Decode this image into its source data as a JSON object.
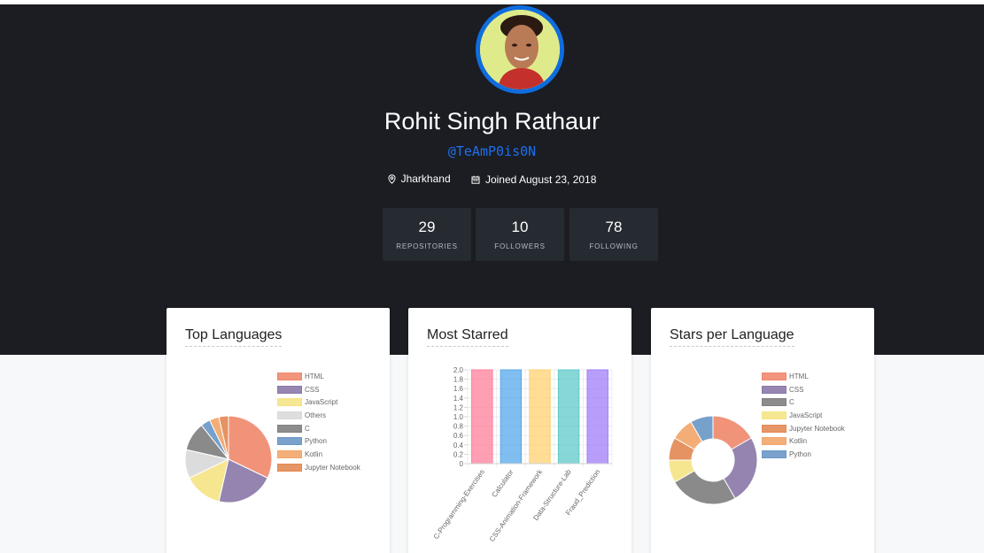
{
  "profile": {
    "name": "Rohit Singh Rathaur",
    "handle": "@TeAmP0is0N",
    "location": "Jharkhand",
    "joined": "Joined August 23, 2018",
    "icons": {
      "location": "map-pin-icon",
      "joined": "calendar-icon"
    },
    "colors": {
      "background": "#1b1d23",
      "handle": "#1f6feb",
      "avatar_ring": "#0f6dde"
    }
  },
  "stats": [
    {
      "value": "29",
      "label": "REPOSITORIES"
    },
    {
      "value": "10",
      "label": "FOLLOWERS"
    },
    {
      "value": "78",
      "label": "FOLLOWING"
    }
  ],
  "cards": {
    "languages": {
      "title": "Top Languages"
    },
    "starred": {
      "title": "Most Starred"
    },
    "stars_per_language": {
      "title": "Stars per Language"
    }
  },
  "chart_data": [
    {
      "type": "pie",
      "title": "Top Languages",
      "labels": [
        "HTML",
        "CSS",
        "JavaScript",
        "Others",
        "C",
        "Python",
        "Kotlin",
        "Jupyter Notebook"
      ],
      "values": [
        9,
        6,
        4,
        3,
        3,
        1,
        1,
        1
      ],
      "colors": [
        "#ef8a6e",
        "#8b79a8",
        "#f5e487",
        "#d9d9d9",
        "#808080",
        "#6b98c7",
        "#f2a66a",
        "#e38a55"
      ],
      "legend": "right"
    },
    {
      "type": "bar",
      "title": "Most Starred",
      "categories": [
        "C-Programming-Exercises",
        "Calculator",
        "CSS-Animation-Framework",
        "Data-Structure-Lab",
        "Fraud_Prediction"
      ],
      "values": [
        2,
        2,
        2,
        2,
        2
      ],
      "colors": [
        "#ff7f9b",
        "#56a8ec",
        "#ffd271",
        "#5fcac9",
        "#a07ef8"
      ],
      "ylim": [
        0,
        2
      ],
      "yticks": [
        "0",
        "0.2",
        "0.4",
        "0.6",
        "0.8",
        "1.0",
        "1.2",
        "1.4",
        "1.6",
        "1.8",
        "2.0"
      ],
      "grid": true
    },
    {
      "type": "pie",
      "title": "Stars per Language",
      "labels": [
        "HTML",
        "CSS",
        "C",
        "JavaScript",
        "Jupyter Notebook",
        "Kotlin",
        "Python"
      ],
      "values": [
        2,
        3,
        3,
        1,
        1,
        1,
        1
      ],
      "colors": [
        "#ef8a6e",
        "#8b79a8",
        "#808080",
        "#f5e487",
        "#e38a55",
        "#f2a66a",
        "#6b98c7"
      ],
      "legend": "right"
    }
  ]
}
